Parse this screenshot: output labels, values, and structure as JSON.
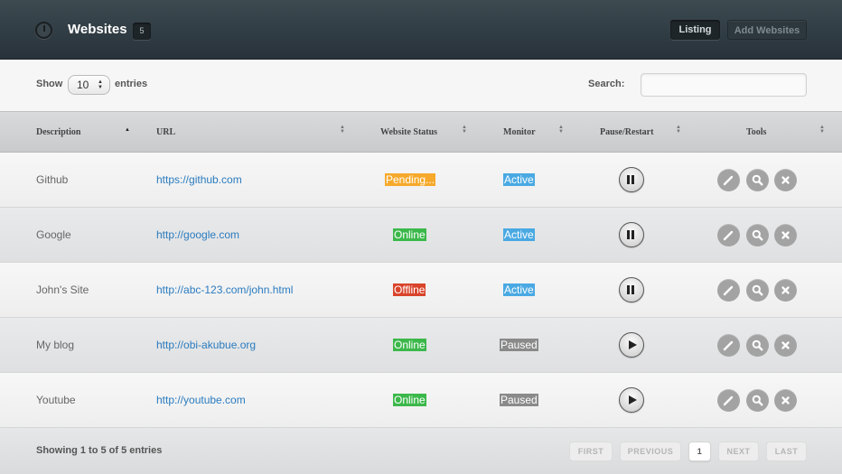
{
  "header": {
    "title": "Websites",
    "count": "5",
    "listing_label": "Listing",
    "add_label": "Add Websites",
    "icon": "clock-icon"
  },
  "controls": {
    "show_label": "Show",
    "entries_value": "10",
    "entries_label": "entries",
    "search_label": "Search:",
    "search_value": ""
  },
  "columns": [
    "Description",
    "URL",
    "Website Status",
    "Monitor",
    "Pause/Restart",
    "Tools"
  ],
  "rows": [
    {
      "description": "Github",
      "url": "https://github.com",
      "status": "Pending...",
      "monitor": "Active",
      "action": "pause"
    },
    {
      "description": "Google",
      "url": "http://google.com",
      "status": "Online",
      "monitor": "Active",
      "action": "pause"
    },
    {
      "description": "John's Site",
      "url": "http://abc-123.com/john.html",
      "status": "Offline",
      "monitor": "Active",
      "action": "pause"
    },
    {
      "description": "My blog",
      "url": "http://obi-akubue.org",
      "status": "Online",
      "monitor": "Paused",
      "action": "play"
    },
    {
      "description": "Youtube",
      "url": "http://youtube.com",
      "status": "Online",
      "monitor": "Paused",
      "action": "play"
    }
  ],
  "tools": [
    "pencil-icon",
    "magnifier-icon",
    "close-icon"
  ],
  "footer": {
    "info": "Showing 1 to 5 of 5 entries",
    "first": "FIRST",
    "previous": "PREVIOUS",
    "page": "1",
    "next": "NEXT",
    "last": "LAST"
  },
  "colors": {
    "pending": "#f6a92b",
    "online": "#3cb84b",
    "offline": "#d9442b",
    "active": "#4aa9e3",
    "paused": "#8a8a8a",
    "link": "#2a7bbf"
  }
}
